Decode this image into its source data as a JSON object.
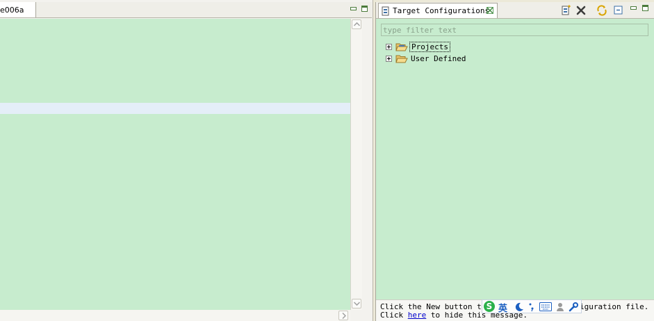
{
  "editor": {
    "tab_label": "e006a"
  },
  "target_view": {
    "tab_title": "Target Configurations",
    "filter_placeholder": "type filter text",
    "tree": [
      {
        "label": "Projects",
        "selected": true
      },
      {
        "label": "User Defined",
        "selected": false
      }
    ],
    "message": {
      "line1_part1": "Click the New button to",
      "line1_part2": "iguration file.",
      "line2_prefix": "Click ",
      "link_text": "here",
      "line2_suffix": " to hide this message."
    }
  },
  "ime": {
    "mode_label": "英",
    "logo_letter": "S"
  },
  "colors": {
    "editor_background": "#c7ecce",
    "highlight_line": "#e4eef8",
    "link": "#0000cc",
    "ime_logo": "#2bb14b",
    "ime_mode": "#1b5fc1"
  }
}
